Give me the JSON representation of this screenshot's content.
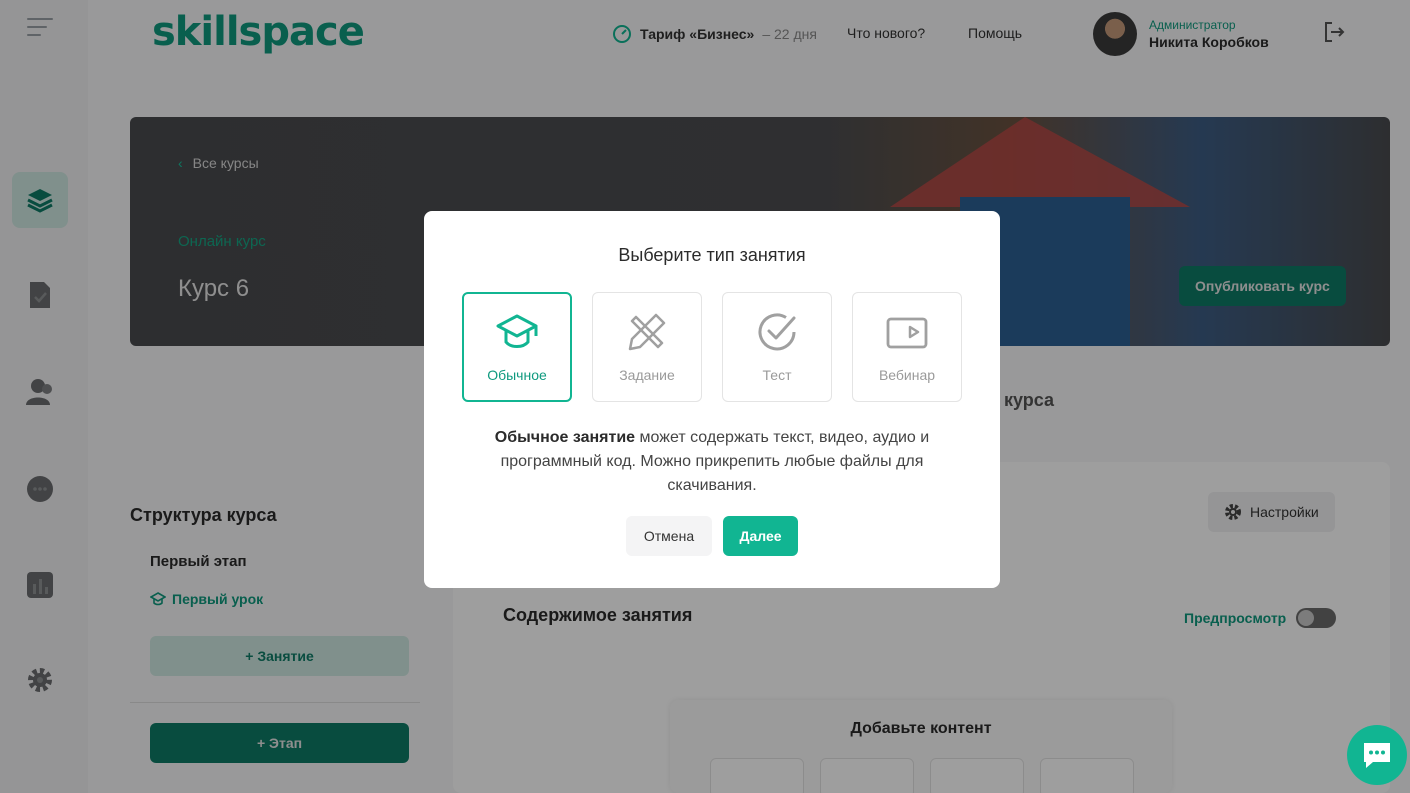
{
  "colors": {
    "accent": "#11b592",
    "accent_dark": "#0e7b66",
    "overlay": "rgba(0,0,0,0.38)"
  },
  "sidebar": {
    "items": [
      {
        "icon": "layers-icon",
        "active": true
      },
      {
        "icon": "document-check-icon",
        "active": false
      },
      {
        "icon": "users-icon",
        "active": false
      },
      {
        "icon": "chat-icon",
        "active": false
      },
      {
        "icon": "analytics-icon",
        "active": false
      },
      {
        "icon": "gear-icon",
        "active": false
      }
    ]
  },
  "header": {
    "logo": "skillspace",
    "tariff_label": "Тариф «Бизнес»",
    "tariff_days": "– 22 дня",
    "whats_new": "Что нового?",
    "help": "Помощь",
    "user_role": "Администратор",
    "user_name": "Никита Коробков"
  },
  "hero": {
    "back": "Все курсы",
    "subtitle": "Онлайн курс",
    "title": "Курс 6",
    "publish": "Опубликовать курс"
  },
  "behind": {
    "heading_fragment": "курса",
    "structure_title": "Структура курса",
    "stage_title": "Первый этап",
    "lesson_title": "Первый урок",
    "add_lesson": "+ Занятие",
    "add_stage": "+ Этап",
    "settings": "Настройки",
    "content_title": "Содержимое занятия",
    "preview": "Предпросмотр",
    "add_content": "Добавьте контент"
  },
  "modal": {
    "title": "Выберите тип занятия",
    "types": [
      {
        "label": "Обычное",
        "icon": "graduation-cap-icon",
        "selected": true
      },
      {
        "label": "Задание",
        "icon": "pencil-ruler-icon",
        "selected": false
      },
      {
        "label": "Тест",
        "icon": "check-circle-icon",
        "selected": false
      },
      {
        "label": "Вебинар",
        "icon": "video-camera-icon",
        "selected": false
      }
    ],
    "description_bold": "Обычное занятие",
    "description_rest": " может содержать текст, видео, аудио и программный код. Можно прикрепить любые файлы для скачивания.",
    "cancel": "Отмена",
    "next": "Далее"
  }
}
